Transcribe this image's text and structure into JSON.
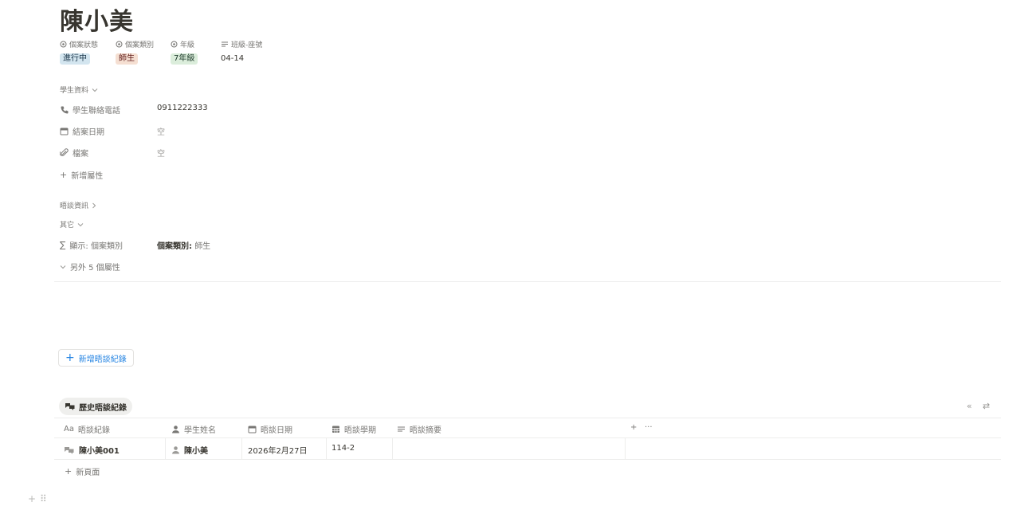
{
  "page": {
    "title": "陳小美"
  },
  "properties_header": {
    "status": "個案狀態",
    "category": "個案類別",
    "grade": "年級",
    "class_seat": "班級-座號"
  },
  "properties_values": {
    "status": "進行中",
    "category": "師生",
    "grade": "7年級",
    "class_seat": "04-14"
  },
  "student_section": {
    "title": "學生資料",
    "phone_label": "學生聯絡電話",
    "phone_value": "0911222333",
    "close_date_label": "結案日期",
    "close_date_value": "空",
    "file_label": "檔案",
    "file_value": "空",
    "add_property": "新增屬性"
  },
  "talk_section": {
    "title": "晤談資訊"
  },
  "other_section": {
    "title": "其它",
    "formula_label": "顯示: 個案類別",
    "formula_value_bold": "個案類別:",
    "formula_value": "師生",
    "more": "另外 5 個屬性"
  },
  "actions": {
    "new_talk_record": "新增晤談紀錄"
  },
  "view": {
    "tab_label": "歷史晤談紀錄"
  },
  "table": {
    "columns": [
      "晤談紀錄",
      "學生姓名",
      "晤談日期",
      "晤談學期",
      "晤談摘要"
    ],
    "add_col": "+",
    "more_col": "···",
    "rows": [
      {
        "record": "陳小美001",
        "student": "陳小美",
        "date": "2026年2月27日",
        "term": "114-2",
        "summary": ""
      }
    ],
    "new_page": "新頁面"
  },
  "corner_icons": {
    "collapse": "«",
    "settings": "⇄"
  },
  "bottom_handle": {
    "plus": "+",
    "drag": "⠿"
  },
  "colors": {
    "accent": "#2383e2",
    "tag_blue": "#d3e5ef",
    "tag_red": "#f5dfd2",
    "tag_green": "#dbeddb"
  }
}
